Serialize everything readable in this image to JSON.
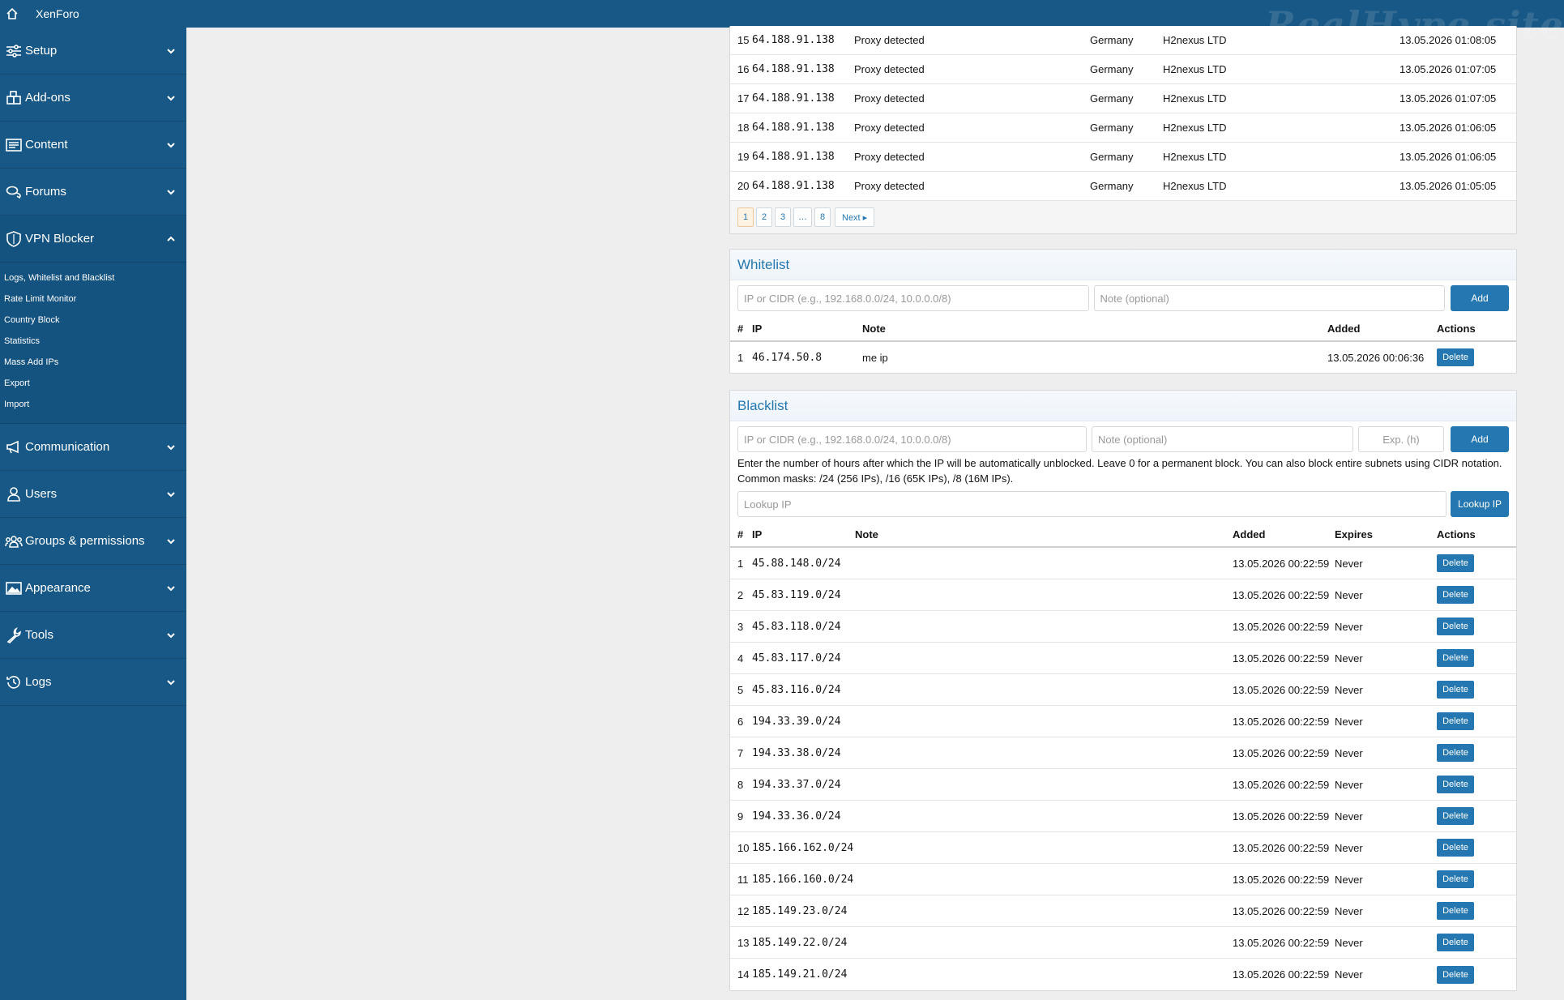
{
  "topbar": {
    "brand": "XenForo",
    "watermark": "RealHype.site"
  },
  "sidebar": {
    "items": [
      {
        "label": "Setup",
        "icon": "sliders-icon"
      },
      {
        "label": "Add-ons",
        "icon": "puzzle-icon"
      },
      {
        "label": "Content",
        "icon": "list-icon"
      },
      {
        "label": "Forums",
        "icon": "chat-icon"
      },
      {
        "label": "VPN Blocker",
        "icon": "shield-icon"
      },
      {
        "label": "Communication",
        "icon": "megaphone-icon"
      },
      {
        "label": "Users",
        "icon": "user-icon"
      },
      {
        "label": "Groups & permissions",
        "icon": "users-icon"
      },
      {
        "label": "Appearance",
        "icon": "image-icon"
      },
      {
        "label": "Tools",
        "icon": "wrench-icon"
      },
      {
        "label": "Logs",
        "icon": "history-icon"
      }
    ],
    "vpn_sub": [
      "Logs, Whitelist and Blacklist",
      "Rate Limit Monitor",
      "Country Block",
      "Statistics",
      "Mass Add IPs",
      "Export",
      "Import"
    ]
  },
  "logs": {
    "rows": [
      {
        "n": "15",
        "ip": "64.188.91.138",
        "reason": "Proxy detected",
        "country": "Germany",
        "isp": "H2nexus LTD",
        "date": "13.05.2026 01:08:05"
      },
      {
        "n": "16",
        "ip": "64.188.91.138",
        "reason": "Proxy detected",
        "country": "Germany",
        "isp": "H2nexus LTD",
        "date": "13.05.2026 01:07:05"
      },
      {
        "n": "17",
        "ip": "64.188.91.138",
        "reason": "Proxy detected",
        "country": "Germany",
        "isp": "H2nexus LTD",
        "date": "13.05.2026 01:07:05"
      },
      {
        "n": "18",
        "ip": "64.188.91.138",
        "reason": "Proxy detected",
        "country": "Germany",
        "isp": "H2nexus LTD",
        "date": "13.05.2026 01:06:05"
      },
      {
        "n": "19",
        "ip": "64.188.91.138",
        "reason": "Proxy detected",
        "country": "Germany",
        "isp": "H2nexus LTD",
        "date": "13.05.2026 01:06:05"
      },
      {
        "n": "20",
        "ip": "64.188.91.138",
        "reason": "Proxy detected",
        "country": "Germany",
        "isp": "H2nexus LTD",
        "date": "13.05.2026 01:05:05"
      }
    ],
    "pager": [
      "1",
      "2",
      "3",
      "…",
      "8"
    ],
    "pager_next": "Next ▸"
  },
  "whitelist": {
    "title": "Whitelist",
    "ip_placeholder": "IP or CIDR (e.g., 192.168.0.0/24, 10.0.0.0/8)",
    "note_placeholder": "Note (optional)",
    "add_label": "Add",
    "columns": {
      "num": "#",
      "ip": "IP",
      "note": "Note",
      "added": "Added",
      "actions": "Actions"
    },
    "rows": [
      {
        "n": "1",
        "ip": "46.174.50.8",
        "note": "me ip",
        "added": "13.05.2026 00:06:36",
        "action": "Delete"
      }
    ]
  },
  "blacklist": {
    "title": "Blacklist",
    "ip_placeholder": "IP or CIDR (e.g., 192.168.0.0/24, 10.0.0.0/8)",
    "note_placeholder": "Note (optional)",
    "exp_placeholder": "Exp. (h)",
    "add_label": "Add",
    "explain": "Enter the number of hours after which the IP will be automatically unblocked. Leave 0 for a permanent block. You can also block entire subnets using CIDR notation. Common masks: /24 (256 IPs), /16 (65K IPs), /8 (16M IPs).",
    "lookup_placeholder": "Lookup IP",
    "lookup_label": "Lookup IP",
    "columns": {
      "num": "#",
      "ip": "IP",
      "note": "Note",
      "added": "Added",
      "expires": "Expires",
      "actions": "Actions"
    },
    "rows": [
      {
        "n": "1",
        "ip": "45.88.148.0/24",
        "added": "13.05.2026 00:22:59",
        "expires": "Never",
        "action": "Delete"
      },
      {
        "n": "2",
        "ip": "45.83.119.0/24",
        "added": "13.05.2026 00:22:59",
        "expires": "Never",
        "action": "Delete"
      },
      {
        "n": "3",
        "ip": "45.83.118.0/24",
        "added": "13.05.2026 00:22:59",
        "expires": "Never",
        "action": "Delete"
      },
      {
        "n": "4",
        "ip": "45.83.117.0/24",
        "added": "13.05.2026 00:22:59",
        "expires": "Never",
        "action": "Delete"
      },
      {
        "n": "5",
        "ip": "45.83.116.0/24",
        "added": "13.05.2026 00:22:59",
        "expires": "Never",
        "action": "Delete"
      },
      {
        "n": "6",
        "ip": "194.33.39.0/24",
        "added": "13.05.2026 00:22:59",
        "expires": "Never",
        "action": "Delete"
      },
      {
        "n": "7",
        "ip": "194.33.38.0/24",
        "added": "13.05.2026 00:22:59",
        "expires": "Never",
        "action": "Delete"
      },
      {
        "n": "8",
        "ip": "194.33.37.0/24",
        "added": "13.05.2026 00:22:59",
        "expires": "Never",
        "action": "Delete"
      },
      {
        "n": "9",
        "ip": "194.33.36.0/24",
        "added": "13.05.2026 00:22:59",
        "expires": "Never",
        "action": "Delete"
      },
      {
        "n": "10",
        "ip": "185.166.162.0/24",
        "added": "13.05.2026 00:22:59",
        "expires": "Never",
        "action": "Delete"
      },
      {
        "n": "11",
        "ip": "185.166.160.0/24",
        "added": "13.05.2026 00:22:59",
        "expires": "Never",
        "action": "Delete"
      },
      {
        "n": "12",
        "ip": "185.149.23.0/24",
        "added": "13.05.2026 00:22:59",
        "expires": "Never",
        "action": "Delete"
      },
      {
        "n": "13",
        "ip": "185.149.22.0/24",
        "added": "13.05.2026 00:22:59",
        "expires": "Never",
        "action": "Delete"
      },
      {
        "n": "14",
        "ip": "185.149.21.0/24",
        "added": "13.05.2026 00:22:59",
        "expires": "Never",
        "action": "Delete"
      }
    ]
  }
}
